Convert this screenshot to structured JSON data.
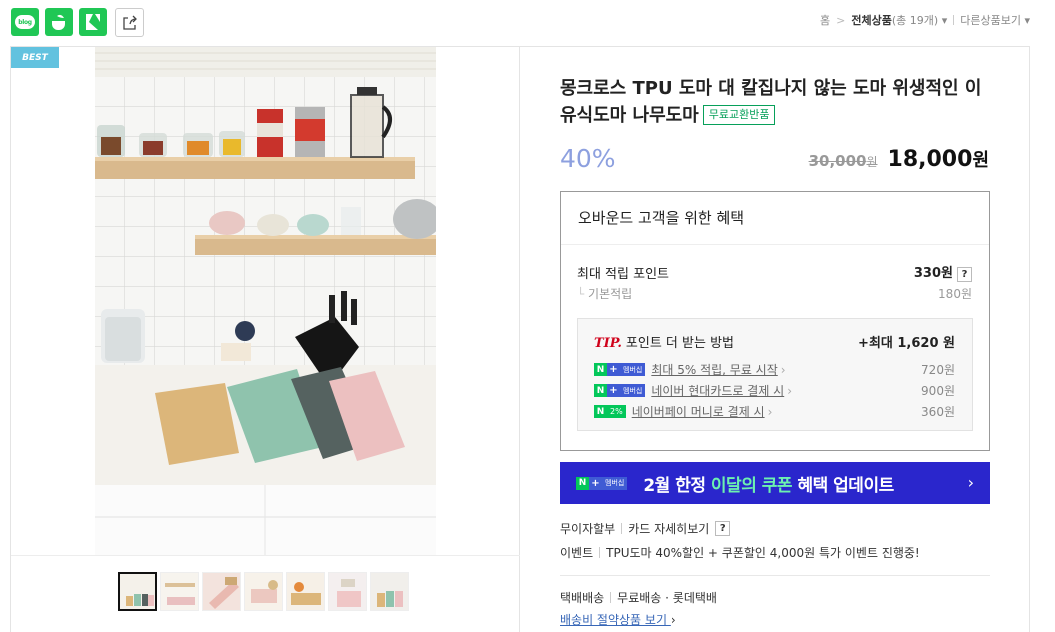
{
  "share": {
    "blog_label": "blog"
  },
  "breadcrumb": {
    "home": "홈",
    "sep": ">",
    "category": "전체상품",
    "count": "(총 19개)",
    "more": "다른상품보기"
  },
  "product": {
    "best_badge": "BEST",
    "title": "몽크로스 TPU 도마 대 칼집나지 않는 도마 위생적인 이유식도마 나무도마",
    "free_exchange": "무료교환반품",
    "discount": "40%",
    "original_price": "30,000",
    "original_unit": "원",
    "sale_price": "18,000",
    "sale_unit": "원"
  },
  "benefit": {
    "heading": "오바운드 고객을 위한 혜택",
    "max_points_label": "최대 적립 포인트",
    "max_points_value": "330원",
    "qmark": "?",
    "basic_label": "기본적립",
    "basic_value": "180원",
    "tip_label": "TIP.",
    "tip_text": "포인트 더 받는 방법",
    "tip_max": "+최대 1,620 원",
    "rows": [
      {
        "text": "최대 5% 적립, 무료 시작",
        "amount": "720원"
      },
      {
        "text": "네이버 현대카드로 결제 시",
        "amount": "900원"
      },
      {
        "text": "네이버페이 머니로 결제 시",
        "amount": "360원"
      }
    ],
    "badge_n": "N",
    "badge_plus": "+",
    "badge_member": "멤버십",
    "badge_pct": "2%"
  },
  "coupon": {
    "prefix": "2월 한정 ",
    "highlight": "이달의 쿠폰",
    "suffix": " 혜택 업데이트",
    "arrow": "›"
  },
  "payment": {
    "installment": "무이자할부",
    "card_detail": "카드 자세히보기",
    "qmark": "?",
    "event_label": "이벤트",
    "event_text": "TPU도마 40%할인 + 쿠폰할인 4,000원 특가 이벤트 진행중!"
  },
  "shipping": {
    "method": "택배배송",
    "detail": "무료배송 · 롯데택배",
    "saving_link": "배송비 절약상품 보기",
    "chev": "›"
  },
  "colors": {
    "naver_green": "#03c75a",
    "coupon_bg": "#2a26cc",
    "discount_blue": "#8da0df",
    "best_bg": "#62c2df"
  }
}
